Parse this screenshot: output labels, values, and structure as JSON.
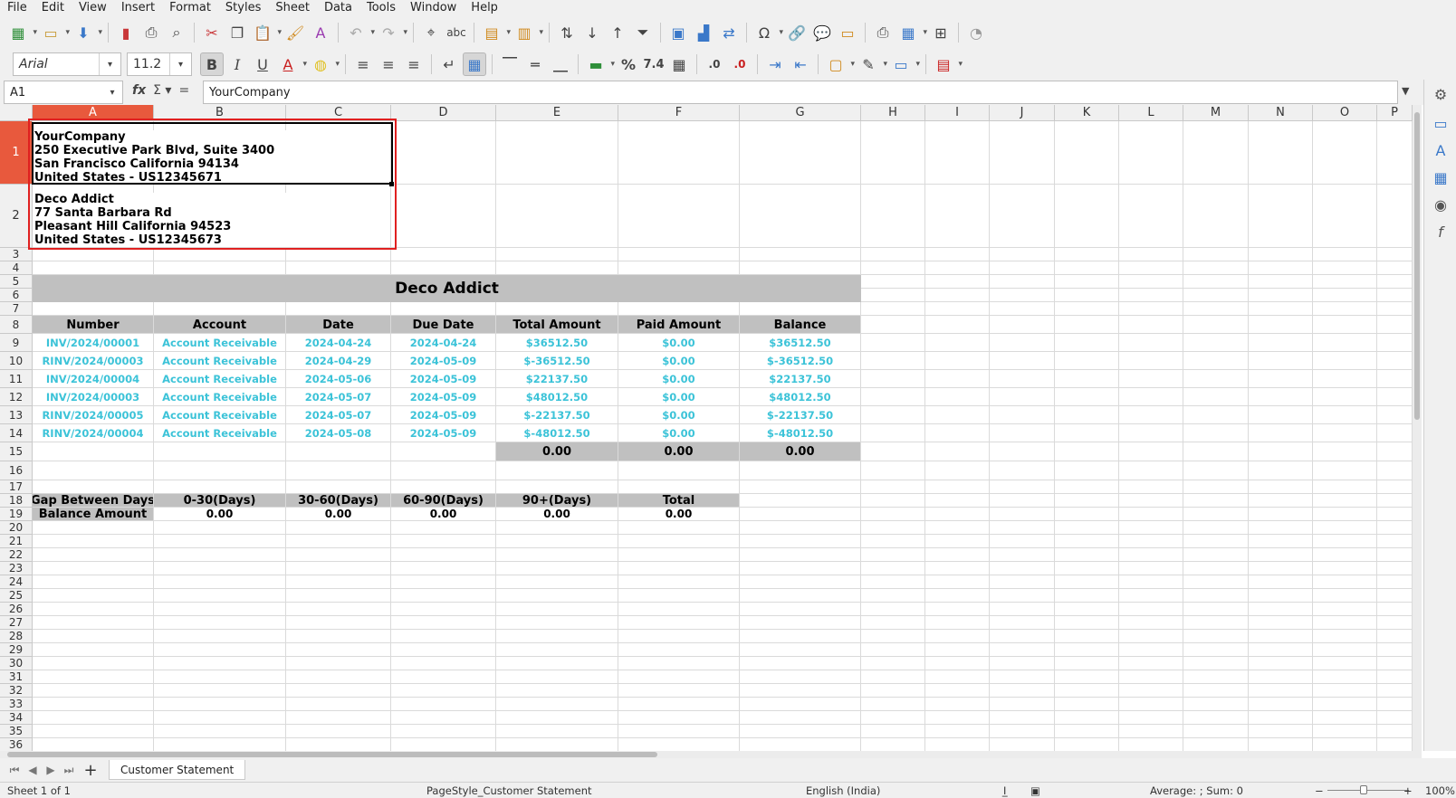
{
  "menu": [
    "File",
    "Edit",
    "View",
    "Insert",
    "Format",
    "Styles",
    "Sheet",
    "Data",
    "Tools",
    "Window",
    "Help"
  ],
  "toolbar": {
    "font_name": "Arial",
    "font_size": "11.2"
  },
  "formula_bar": {
    "name_box": "A1",
    "content": "YourCompany"
  },
  "columns": [
    "A",
    "B",
    "C",
    "D",
    "E",
    "F",
    "G",
    "H",
    "I",
    "J",
    "K",
    "L",
    "M",
    "N",
    "O",
    "P"
  ],
  "rows": [
    "1",
    "2",
    "3",
    "4",
    "5",
    "6",
    "7",
    "8",
    "9",
    "10",
    "11",
    "12",
    "13",
    "14",
    "15",
    "16",
    "17",
    "18",
    "19",
    "20",
    "21",
    "22",
    "23",
    "24",
    "25",
    "26",
    "27",
    "28",
    "29",
    "30",
    "31",
    "32",
    "33",
    "34",
    "35",
    "36"
  ],
  "company_address": "YourCompany\n250 Executive Park Blvd, Suite 3400\nSan Francisco California 94134\nUnited States - US12345671",
  "customer_address": "Deco Addict\n77 Santa Barbara Rd\nPleasant Hill California 94523\nUnited States - US12345673",
  "statement_title": "Deco Addict",
  "table": {
    "headers": [
      "Number",
      "Account",
      "Date",
      "Due Date",
      "Total Amount",
      "Paid Amount",
      "Balance"
    ],
    "rows": [
      [
        "INV/2024/00001",
        "Account Receivable",
        "2024-04-24",
        "2024-04-24",
        "$36512.50",
        "$0.00",
        "$36512.50"
      ],
      [
        "RINV/2024/00003",
        "Account Receivable",
        "2024-04-29",
        "2024-05-09",
        "$-36512.50",
        "$0.00",
        "$-36512.50"
      ],
      [
        "INV/2024/00004",
        "Account Receivable",
        "2024-05-06",
        "2024-05-09",
        "$22137.50",
        "$0.00",
        "$22137.50"
      ],
      [
        "INV/2024/00003",
        "Account Receivable",
        "2024-05-07",
        "2024-05-09",
        "$48012.50",
        "$0.00",
        "$48012.50"
      ],
      [
        "RINV/2024/00005",
        "Account Receivable",
        "2024-05-07",
        "2024-05-09",
        "$-22137.50",
        "$0.00",
        "$-22137.50"
      ],
      [
        "RINV/2024/00004",
        "Account Receivable",
        "2024-05-08",
        "2024-05-09",
        "$-48012.50",
        "$0.00",
        "$-48012.50"
      ]
    ],
    "totals": [
      "0.00",
      "0.00",
      "0.00"
    ]
  },
  "aging": {
    "headers": [
      "Gap Between Days",
      "0-30(Days)",
      "30-60(Days)",
      "60-90(Days)",
      "90+(Days)",
      "Total"
    ],
    "row_label": "Balance Amount",
    "values": [
      "0.00",
      "0.00",
      "0.00",
      "0.00",
      "0.00"
    ]
  },
  "sheet_tab": "Customer Statement",
  "status": {
    "sheet": "Sheet 1 of 1",
    "page_style": "PageStyle_Customer Statement",
    "language": "English (India)",
    "summary": "Average: ; Sum: 0",
    "zoom": "100%"
  },
  "colors": {
    "selection_header": "#e8593d",
    "data_text": "#3cc3d8",
    "header_fill": "#c0c0c0",
    "selection_outline": "#e02020"
  }
}
